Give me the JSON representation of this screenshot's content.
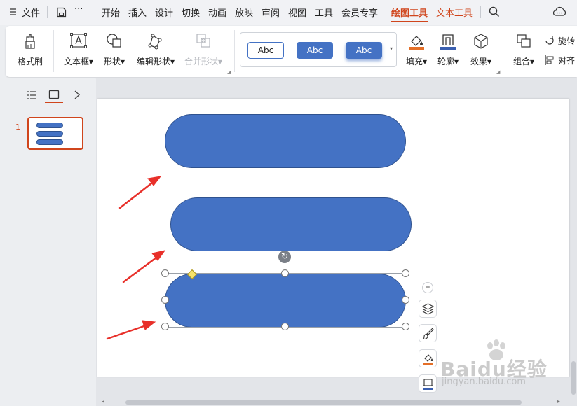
{
  "menu": {
    "app_menu": "文件",
    "more": "···",
    "tabs": [
      "开始",
      "插入",
      "设计",
      "切换",
      "动画",
      "放映",
      "审阅",
      "视图",
      "工具",
      "会员专享"
    ],
    "tool_tabs": [
      "绘图工具",
      "文本工具"
    ],
    "active_tab": "绘图工具"
  },
  "ribbon": {
    "format_painter": "格式刷",
    "textbox": "文本框",
    "shape": "形状",
    "edit_shape": "编辑形状",
    "merge_shape": "合并形状",
    "style_samples": [
      "Abc",
      "Abc",
      "Abc"
    ],
    "fill": "填充",
    "outline": "轮廓",
    "effect": "效果",
    "group": "组合",
    "rotate": "旋转",
    "align": "对齐"
  },
  "slides_panel": {
    "slide_number": "1"
  },
  "watermark": {
    "logo_text": "Baidu经验",
    "url": "jingyan.baidu.com"
  },
  "colors": {
    "accent": "#d0451c",
    "shape_fill": "#4472c4",
    "shape_border": "#2f528f",
    "arrow": "#e8302a"
  }
}
